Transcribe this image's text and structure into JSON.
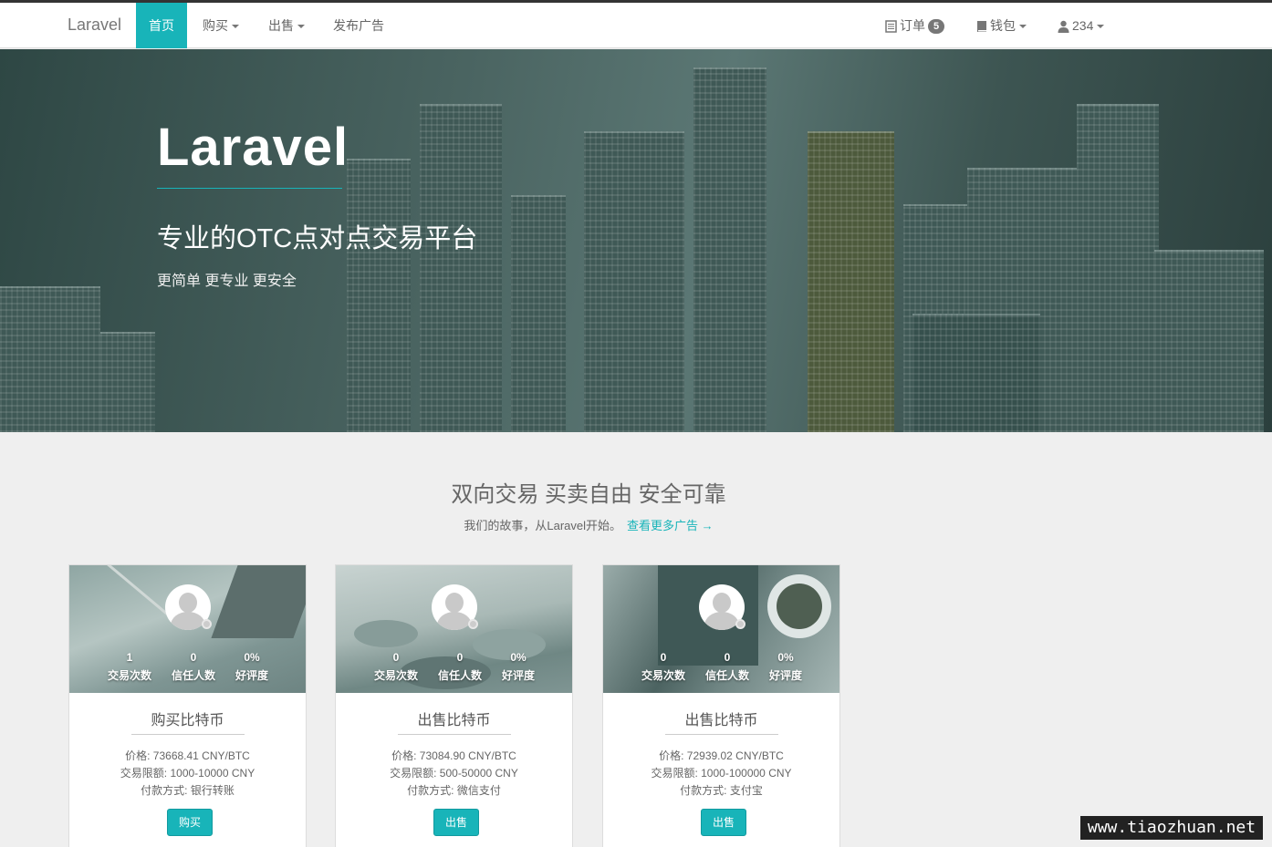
{
  "nav": {
    "brand": "Laravel",
    "home": "首页",
    "buy": "购买",
    "sell": "出售",
    "publish": "发布广告",
    "orders": "订单",
    "orders_badge": "5",
    "wallet": "钱包",
    "user": "234"
  },
  "hero": {
    "title": "Laravel",
    "subtitle": "专业的OTC点对点交易平台",
    "tagline": "更简单 更专业 更安全"
  },
  "section": {
    "title": "双向交易 买卖自由 安全可靠",
    "desc": "我们的故事，从Laravel开始。",
    "more_link": "查看更多广告 →"
  },
  "cards": [
    {
      "trades": "1",
      "trades_label": "交易次数",
      "trust": "0",
      "trust_label": "信任人数",
      "rating": "0%",
      "rating_label": "好评度",
      "title": "购买比特币",
      "price": "价格: 73668.41 CNY/BTC",
      "limit": "交易限额: 1000-10000 CNY",
      "payment": "付款方式: 银行转账",
      "button": "购买"
    },
    {
      "trades": "0",
      "trades_label": "交易次数",
      "trust": "0",
      "trust_label": "信任人数",
      "rating": "0%",
      "rating_label": "好评度",
      "title": "出售比特币",
      "price": "价格: 73084.90 CNY/BTC",
      "limit": "交易限额: 500-50000 CNY",
      "payment": "付款方式: 微信支付",
      "button": "出售"
    },
    {
      "trades": "0",
      "trades_label": "交易次数",
      "trust": "0",
      "trust_label": "信任人数",
      "rating": "0%",
      "rating_label": "好评度",
      "title": "出售比特币",
      "price": "价格: 72939.02 CNY/BTC",
      "limit": "交易限额: 1000-100000 CNY",
      "payment": "付款方式: 支付宝",
      "button": "出售"
    }
  ],
  "watermark": "www.tiaozhuan.net",
  "colors": {
    "accent": "#18b4b9",
    "navbar_bg": "#ffffff",
    "page_bg": "#efefef"
  }
}
